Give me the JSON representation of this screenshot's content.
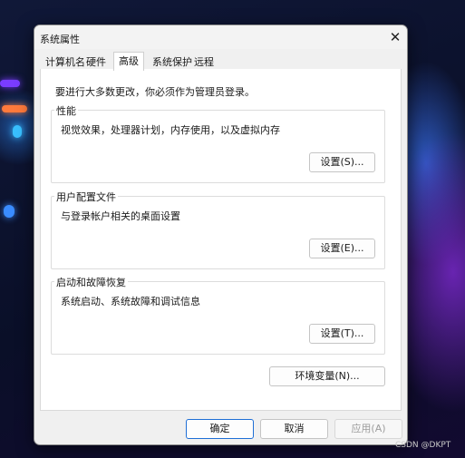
{
  "window": {
    "title": "系统属性"
  },
  "tabs": [
    {
      "label": "计算机名"
    },
    {
      "label": "硬件"
    },
    {
      "label": "高级",
      "active": true
    },
    {
      "label": "系统保护"
    },
    {
      "label": "远程"
    }
  ],
  "advanced": {
    "admin_note": "要进行大多数更改，你必须作为管理员登录。",
    "performance": {
      "title": "性能",
      "description": "视觉效果，处理器计划，内存使用，以及虚拟内存",
      "button": "设置(S)..."
    },
    "user_profiles": {
      "title": "用户配置文件",
      "description": "与登录帐户相关的桌面设置",
      "button": "设置(E)..."
    },
    "startup_recovery": {
      "title": "启动和故障恢复",
      "description": "系统启动、系统故障和调试信息",
      "button": "设置(T)..."
    },
    "env_button": "环境变量(N)..."
  },
  "footer": {
    "ok": "确定",
    "cancel": "取消",
    "apply": "应用(A)"
  },
  "watermark": "CSDN @DKPT",
  "colors": {
    "accent_border": "#1f6fd6",
    "dialog_bg": "#f0f0f0"
  },
  "icons": {
    "close": "close-icon"
  }
}
